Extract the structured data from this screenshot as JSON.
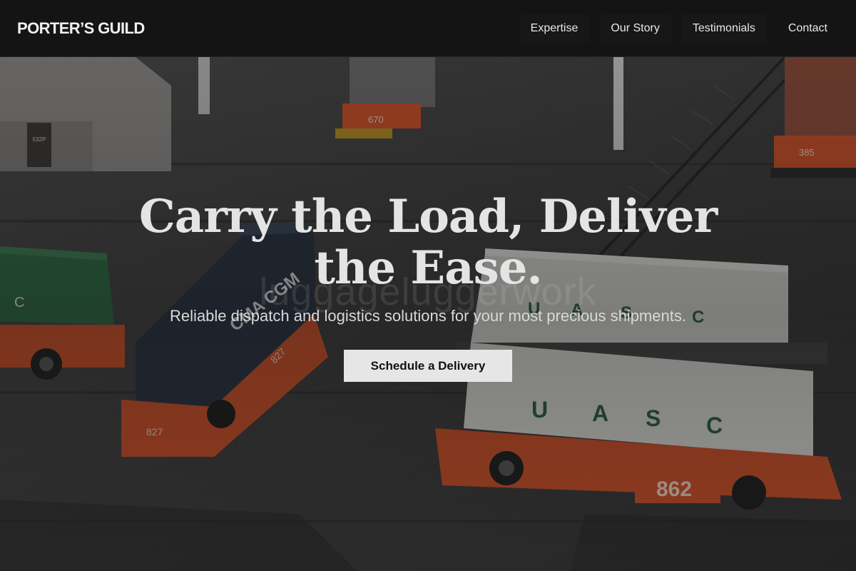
{
  "nav": {
    "brand": "PORTER’S GUILD",
    "links": [
      {
        "label": "Expertise"
      },
      {
        "label": "Our Story"
      },
      {
        "label": "Testimonials"
      },
      {
        "label": "Contact"
      }
    ]
  },
  "hero": {
    "title": "Carry the Load, Deliver the Ease.",
    "watermark": "luggageluggerwork",
    "subtitle": "Reliable dispatch and logistics solutions for your most precious shipments.",
    "cta_label": "Schedule a Delivery"
  },
  "photo": {
    "description_icon": "container-terminal-image",
    "container_markings": [
      "UASC",
      "UASC",
      "CMA CGM",
      "C"
    ],
    "vehicle_numbers": [
      "670",
      "385",
      "827",
      "827",
      "862"
    ],
    "building_number": "532P"
  },
  "colors": {
    "nav_bg": "#141414",
    "cta_bg": "#e6e6e6",
    "title_text": "#e4e4e4",
    "vehicle_orange": "#c8502a"
  }
}
